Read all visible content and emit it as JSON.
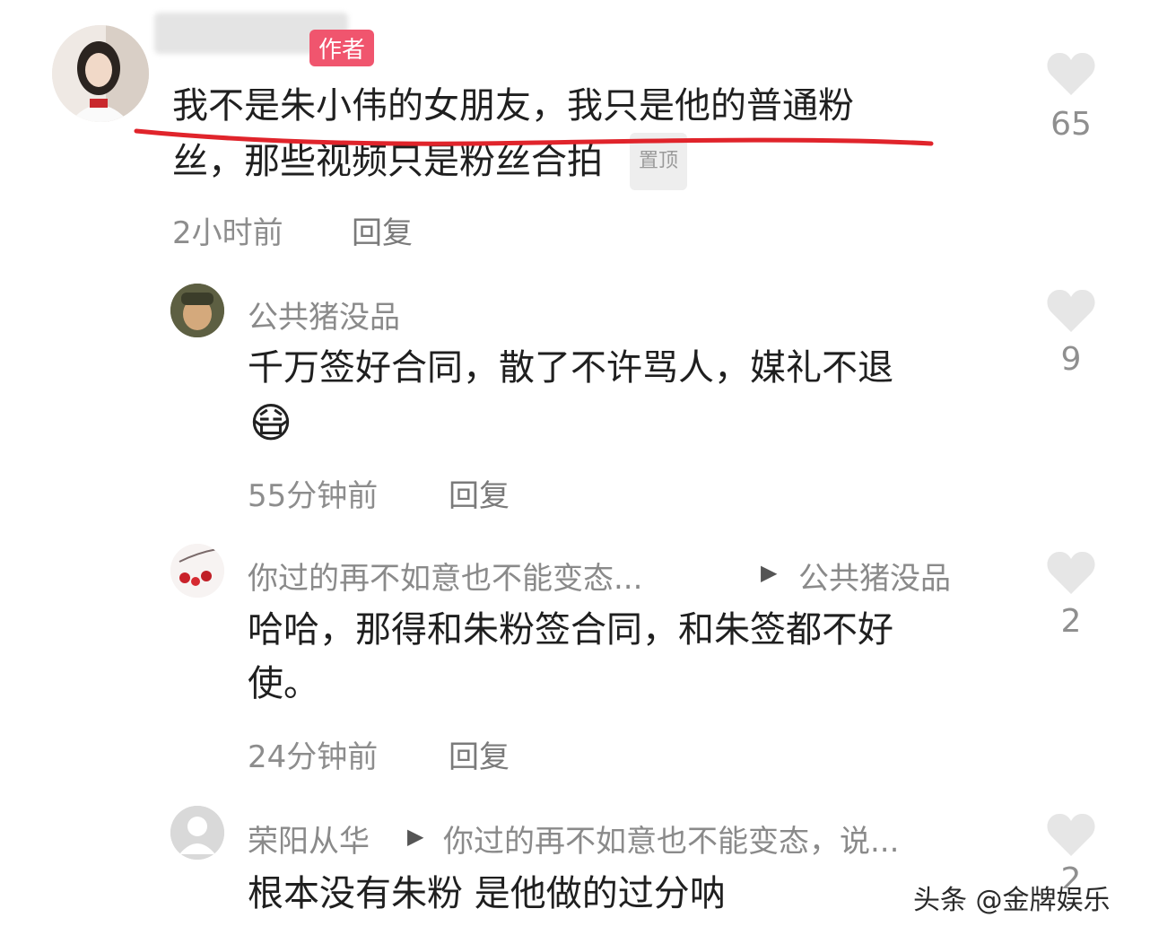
{
  "comments": [
    {
      "badge": "作者",
      "text": "我不是朱小伟的女朋友，我只是他的普通粉丝，那些视频只是粉丝合拍",
      "text_line1": "我不是朱小伟的女朋友，我只是他的普通粉",
      "text_line2": "丝，那些视频只是粉丝合拍",
      "pinned_label": "置顶",
      "time": "2小时前",
      "reply_label": "回复",
      "likes": "65"
    },
    {
      "username": "公共猪没品",
      "text": "千万签好合同，散了不许骂人，媒礼不退",
      "emoji": "😷",
      "time": "55分钟前",
      "reply_label": "回复",
      "likes": "9"
    },
    {
      "username": "你过的再不如意也不能变态...",
      "reply_to": "公共猪没品",
      "text": "哈哈，那得和朱粉签合同，和朱签都不好使。",
      "text_line1": "哈哈，那得和朱粉签合同，和朱签都不好",
      "text_line2": "使。",
      "time": "24分钟前",
      "reply_label": "回复",
      "likes": "2"
    },
    {
      "username": "荣阳从华",
      "reply_to": "你过的再不如意也不能变态，说...",
      "text": "根本没有朱粉 是他做的过分呐",
      "likes": "2"
    }
  ],
  "watermark": "头条 @金牌娱乐",
  "colors": {
    "accent_red": "#e0242b",
    "badge_pink": "#f0556e",
    "heart_gray": "#e6e6e6"
  },
  "icons": [
    "heart-icon",
    "reply-arrow-icon",
    "avatar-placeholder-icon"
  ]
}
